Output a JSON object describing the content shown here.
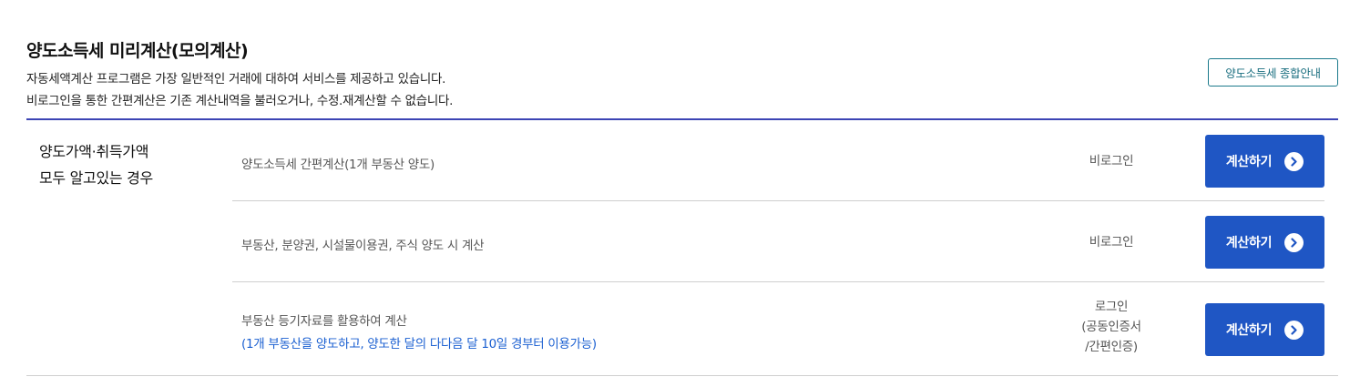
{
  "header": {
    "title": "양도소득세 미리계산(모의계산)",
    "desc_line1": "자동세액계산 프로그램은 가장 일반적인 거래에 대하여 서비스를 제공하고 있습니다.",
    "desc_line2": "비로그인을 통한 간편계산은 기존 계산내역을 불러오거나, 수정.재계산할 수 없습니다.",
    "guide_button": "양도소득세 종합안내"
  },
  "category": {
    "line1": "양도가액·취득가액",
    "line2": "모두 알고있는 경우"
  },
  "rows": [
    {
      "title": "양도소득세 간편계산(1개 부동산 양도)",
      "auth_line1": "비로그인",
      "button": "계산하기"
    },
    {
      "title": "부동산, 분양권, 시설물이용권, 주식 양도 시 계산",
      "auth_line1": "비로그인",
      "button": "계산하기"
    },
    {
      "title": "부동산 등기자료를 활용하여 계산",
      "note": "(1개 부동산을 양도하고, 양도한 달의 다다음 달 10일 경부터 이용가능)",
      "auth_line1": "로그인",
      "auth_line2": "(공동인증서",
      "auth_line3": "/간편인증)",
      "button": "계산하기"
    }
  ],
  "icons": {
    "button_arrow": "chevron-right-circle-icon"
  },
  "colors": {
    "accent": "#1f56c4",
    "rule": "#3c44b4",
    "note": "#1a5fd1",
    "guide_border": "#1b7a8c"
  }
}
